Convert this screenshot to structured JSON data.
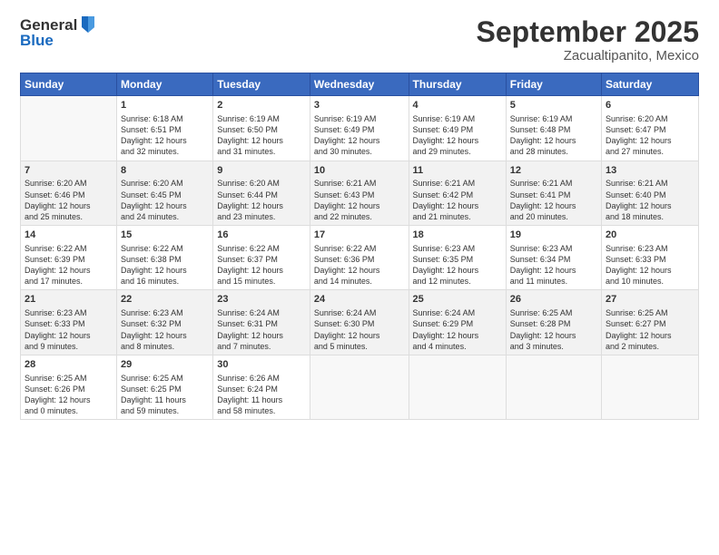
{
  "header": {
    "logo_line1": "General",
    "logo_line2": "Blue",
    "month_title": "September 2025",
    "location": "Zacualtipanito, Mexico"
  },
  "weekdays": [
    "Sunday",
    "Monday",
    "Tuesday",
    "Wednesday",
    "Thursday",
    "Friday",
    "Saturday"
  ],
  "weeks": [
    [
      {
        "num": "",
        "info": ""
      },
      {
        "num": "1",
        "info": "Sunrise: 6:18 AM\nSunset: 6:51 PM\nDaylight: 12 hours\nand 32 minutes."
      },
      {
        "num": "2",
        "info": "Sunrise: 6:19 AM\nSunset: 6:50 PM\nDaylight: 12 hours\nand 31 minutes."
      },
      {
        "num": "3",
        "info": "Sunrise: 6:19 AM\nSunset: 6:49 PM\nDaylight: 12 hours\nand 30 minutes."
      },
      {
        "num": "4",
        "info": "Sunrise: 6:19 AM\nSunset: 6:49 PM\nDaylight: 12 hours\nand 29 minutes."
      },
      {
        "num": "5",
        "info": "Sunrise: 6:19 AM\nSunset: 6:48 PM\nDaylight: 12 hours\nand 28 minutes."
      },
      {
        "num": "6",
        "info": "Sunrise: 6:20 AM\nSunset: 6:47 PM\nDaylight: 12 hours\nand 27 minutes."
      }
    ],
    [
      {
        "num": "7",
        "info": "Sunrise: 6:20 AM\nSunset: 6:46 PM\nDaylight: 12 hours\nand 25 minutes."
      },
      {
        "num": "8",
        "info": "Sunrise: 6:20 AM\nSunset: 6:45 PM\nDaylight: 12 hours\nand 24 minutes."
      },
      {
        "num": "9",
        "info": "Sunrise: 6:20 AM\nSunset: 6:44 PM\nDaylight: 12 hours\nand 23 minutes."
      },
      {
        "num": "10",
        "info": "Sunrise: 6:21 AM\nSunset: 6:43 PM\nDaylight: 12 hours\nand 22 minutes."
      },
      {
        "num": "11",
        "info": "Sunrise: 6:21 AM\nSunset: 6:42 PM\nDaylight: 12 hours\nand 21 minutes."
      },
      {
        "num": "12",
        "info": "Sunrise: 6:21 AM\nSunset: 6:41 PM\nDaylight: 12 hours\nand 20 minutes."
      },
      {
        "num": "13",
        "info": "Sunrise: 6:21 AM\nSunset: 6:40 PM\nDaylight: 12 hours\nand 18 minutes."
      }
    ],
    [
      {
        "num": "14",
        "info": "Sunrise: 6:22 AM\nSunset: 6:39 PM\nDaylight: 12 hours\nand 17 minutes."
      },
      {
        "num": "15",
        "info": "Sunrise: 6:22 AM\nSunset: 6:38 PM\nDaylight: 12 hours\nand 16 minutes."
      },
      {
        "num": "16",
        "info": "Sunrise: 6:22 AM\nSunset: 6:37 PM\nDaylight: 12 hours\nand 15 minutes."
      },
      {
        "num": "17",
        "info": "Sunrise: 6:22 AM\nSunset: 6:36 PM\nDaylight: 12 hours\nand 14 minutes."
      },
      {
        "num": "18",
        "info": "Sunrise: 6:23 AM\nSunset: 6:35 PM\nDaylight: 12 hours\nand 12 minutes."
      },
      {
        "num": "19",
        "info": "Sunrise: 6:23 AM\nSunset: 6:34 PM\nDaylight: 12 hours\nand 11 minutes."
      },
      {
        "num": "20",
        "info": "Sunrise: 6:23 AM\nSunset: 6:33 PM\nDaylight: 12 hours\nand 10 minutes."
      }
    ],
    [
      {
        "num": "21",
        "info": "Sunrise: 6:23 AM\nSunset: 6:33 PM\nDaylight: 12 hours\nand 9 minutes."
      },
      {
        "num": "22",
        "info": "Sunrise: 6:23 AM\nSunset: 6:32 PM\nDaylight: 12 hours\nand 8 minutes."
      },
      {
        "num": "23",
        "info": "Sunrise: 6:24 AM\nSunset: 6:31 PM\nDaylight: 12 hours\nand 7 minutes."
      },
      {
        "num": "24",
        "info": "Sunrise: 6:24 AM\nSunset: 6:30 PM\nDaylight: 12 hours\nand 5 minutes."
      },
      {
        "num": "25",
        "info": "Sunrise: 6:24 AM\nSunset: 6:29 PM\nDaylight: 12 hours\nand 4 minutes."
      },
      {
        "num": "26",
        "info": "Sunrise: 6:25 AM\nSunset: 6:28 PM\nDaylight: 12 hours\nand 3 minutes."
      },
      {
        "num": "27",
        "info": "Sunrise: 6:25 AM\nSunset: 6:27 PM\nDaylight: 12 hours\nand 2 minutes."
      }
    ],
    [
      {
        "num": "28",
        "info": "Sunrise: 6:25 AM\nSunset: 6:26 PM\nDaylight: 12 hours\nand 0 minutes."
      },
      {
        "num": "29",
        "info": "Sunrise: 6:25 AM\nSunset: 6:25 PM\nDaylight: 11 hours\nand 59 minutes."
      },
      {
        "num": "30",
        "info": "Sunrise: 6:26 AM\nSunset: 6:24 PM\nDaylight: 11 hours\nand 58 minutes."
      },
      {
        "num": "",
        "info": ""
      },
      {
        "num": "",
        "info": ""
      },
      {
        "num": "",
        "info": ""
      },
      {
        "num": "",
        "info": ""
      }
    ]
  ]
}
